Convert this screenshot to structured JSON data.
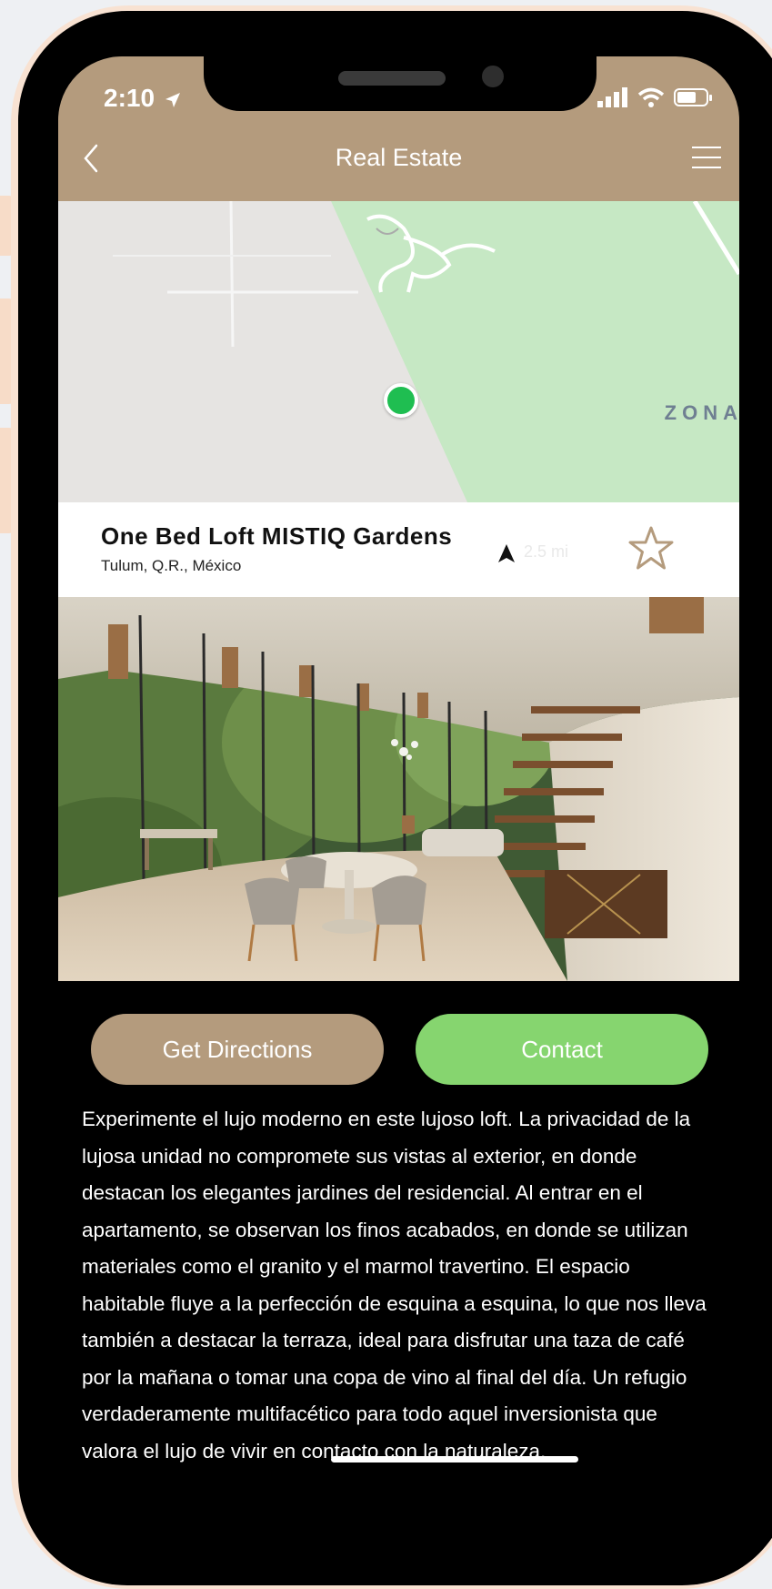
{
  "status_bar": {
    "time": "2:10"
  },
  "header": {
    "title": "Real Estate"
  },
  "map": {
    "area_label": "ZONA"
  },
  "listing": {
    "title": "One Bed Loft MISTIQ Gardens",
    "location": "Tulum, Q.R., México",
    "distance": "2.5 mi"
  },
  "actions": {
    "directions_label": "Get Directions",
    "contact_label": "Contact"
  },
  "description": "Experimente el lujo moderno en este lujoso loft. La privacidad de la lujosa unidad no compromete sus vistas al exterior, en donde destacan los elegantes jardines del residencial. Al entrar en el apartamento, se observan los finos acabados, en donde se utilizan materiales como el granito y el marmol travertino. El espacio habitable fluye a la perfección de esquina a esquina, lo que nos lleva también a destacar la terraza, ideal para disfrutar una taza de café por la mañana o tomar una copa de vino al final del día. Un refugio verdaderamente multifacético para todo aquel inversionista que valora el lujo de vivir en contacto con la naturaleza.",
  "colors": {
    "header_bg": "#b49b7d",
    "directions_bg": "#b49b7d",
    "contact_bg": "#86d56f",
    "map_pin": "#1fbe51",
    "map_park": "#c6e8c4"
  },
  "icons": [
    "back-chevron-icon",
    "hamburger-menu-icon",
    "navigation-arrow-icon",
    "star-outline-icon",
    "signal-icon",
    "wifi-icon",
    "battery-icon",
    "location-arrow-icon"
  ]
}
